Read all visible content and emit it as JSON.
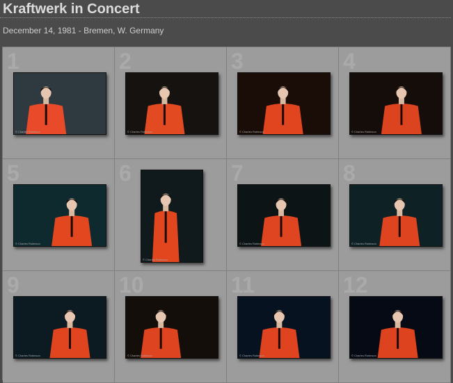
{
  "header": {
    "title": "Kraftwerk in Concert",
    "subtitle": "December 14, 1981 - Bremen, W. Germany"
  },
  "photos": [
    {
      "number": "1",
      "orientation": "landscape",
      "bg": "#2f3a40",
      "shirt": "#e84a2a"
    },
    {
      "number": "2",
      "orientation": "landscape",
      "bg": "#15120f",
      "shirt": "#e24a22"
    },
    {
      "number": "3",
      "orientation": "landscape",
      "bg": "#1a0d08",
      "shirt": "#e0451f"
    },
    {
      "number": "4",
      "orientation": "landscape",
      "bg": "#150d09",
      "shirt": "#dc441f"
    },
    {
      "number": "5",
      "orientation": "landscape",
      "bg": "#0f2a2e",
      "shirt": "#e2471f"
    },
    {
      "number": "6",
      "orientation": "portrait",
      "bg": "#101a1c",
      "shirt": "#e2461f"
    },
    {
      "number": "7",
      "orientation": "landscape",
      "bg": "#0c1416",
      "shirt": "#df4520"
    },
    {
      "number": "8",
      "orientation": "landscape",
      "bg": "#0e2226",
      "shirt": "#de441f"
    },
    {
      "number": "9",
      "orientation": "landscape",
      "bg": "#0c1a22",
      "shirt": "#e04520"
    },
    {
      "number": "10",
      "orientation": "landscape",
      "bg": "#140e0a",
      "shirt": "#df4421"
    },
    {
      "number": "11",
      "orientation": "landscape",
      "bg": "#071220",
      "shirt": "#df4320"
    },
    {
      "number": "12",
      "orientation": "landscape",
      "bg": "#050a14",
      "shirt": "#de4320"
    }
  ],
  "credit": "© Charles Robinson",
  "colors": {
    "page_bg": "#4a4a4a",
    "grid_bg": "#9c9c9c",
    "title": "#dcdcdc"
  }
}
